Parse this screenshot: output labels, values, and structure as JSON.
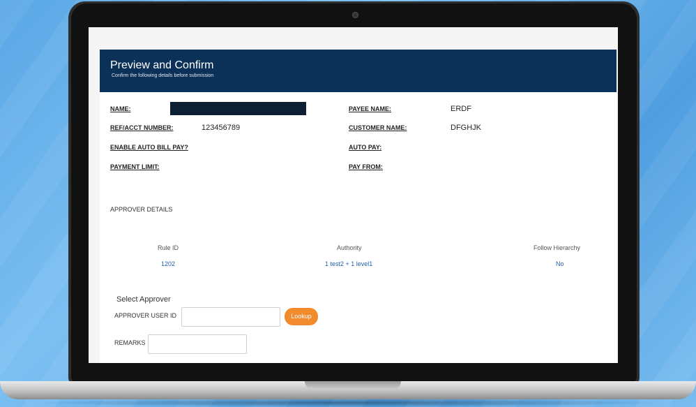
{
  "header": {
    "title": "Preview and Confirm",
    "subtitle": "Confirm the following details before submission"
  },
  "details": {
    "name_label": "NAME:",
    "ref_label": "REF/ACCT NUMBER:",
    "ref_value": "123456789",
    "auto_bill_label": "ENABLE AUTO BILL PAY?",
    "payment_limit_label": "PAYMENT LIMIT:",
    "payee_name_label": "PAYEE NAME:",
    "payee_name_value": "ERDF",
    "customer_name_label": "CUSTOMER NAME:",
    "customer_name_value": "DFGHJK",
    "auto_pay_label": "AUTO PAY:",
    "pay_from_label": "PAY FROM:"
  },
  "approver": {
    "section_title": "APPROVER DETAILS",
    "columns": [
      "Rule ID",
      "Authority",
      "Follow Hierarchy"
    ],
    "row": [
      "1202",
      "1 test2 + 1 level1",
      "No"
    ]
  },
  "form": {
    "select_title": "Select Approver",
    "user_id_label": "APPROVER USER ID",
    "lookup_label": "Lookup",
    "remarks_label": "REMARKS"
  },
  "colors": {
    "header_bg": "#0c3158",
    "accent": "#f28a2e",
    "link": "#1f5fa8"
  }
}
